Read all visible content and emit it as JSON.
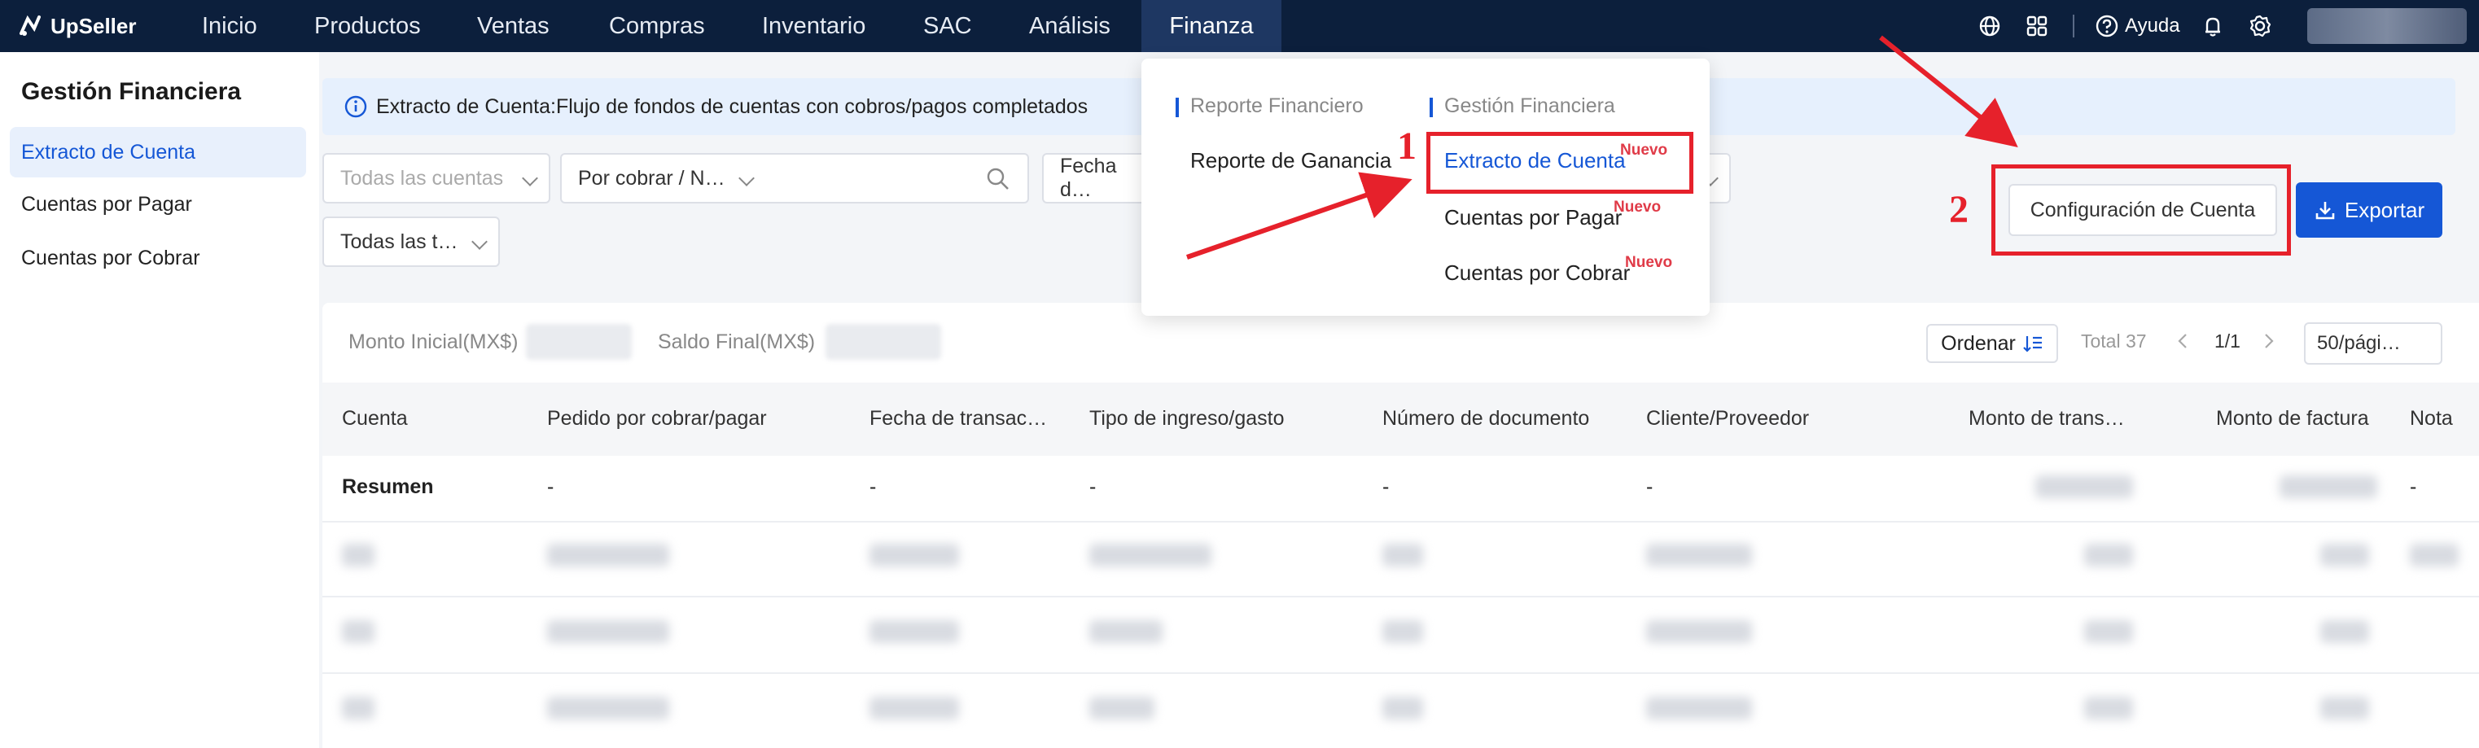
{
  "brand": "UpSeller",
  "nav": {
    "items": [
      "Inicio",
      "Productos",
      "Ventas",
      "Compras",
      "Inventario",
      "SAC",
      "Análisis",
      "Finanza"
    ],
    "active": "Finanza",
    "help_label": "Ayuda",
    "icons": [
      "globe-icon",
      "apps-grid-icon",
      "help-circle-icon",
      "bell-icon",
      "gear-icon"
    ]
  },
  "sidebar": {
    "title": "Gestión Financiera",
    "items": [
      {
        "label": "Extracto de Cuenta",
        "active": true
      },
      {
        "label": "Cuentas por Pagar",
        "active": false
      },
      {
        "label": "Cuentas por Cobrar",
        "active": false
      }
    ]
  },
  "banner": {
    "text": "Extracto de Cuenta:Flujo de fondos de cuentas con cobros/pagos completados"
  },
  "filters": {
    "accounts_placeholder": "Todas las cuentas",
    "status": "Por cobrar / N…",
    "search_value": "",
    "date": "Fecha d…",
    "types": "Todas las t…"
  },
  "actions": {
    "config_label": "Configuración de Cuenta",
    "export_label": "Exportar"
  },
  "summary": {
    "initial_label": "Monto Inicial(MX$)",
    "final_label": "Saldo Final(MX$)"
  },
  "pager": {
    "sort_label": "Ordenar",
    "total": "Total 37",
    "current": "1/1",
    "page_size": "50/pági…"
  },
  "table": {
    "columns": [
      "Cuenta",
      "Pedido por cobrar/pagar",
      "Fecha de transac…",
      "Tipo de ingreso/gasto",
      "Número de documento",
      "Cliente/Proveedor",
      "Monto de trans…",
      "Monto de factura",
      "Nota"
    ],
    "summary_row": {
      "label": "Resumen",
      "dash": "-"
    }
  },
  "dropdown": {
    "col1_head": "Reporte Financiero",
    "col1_items": [
      "Reporte de Ganancia"
    ],
    "col2_head": "Gestión Financiera",
    "col2_items": [
      "Extracto de Cuenta",
      "Cuentas por Pagar",
      "Cuentas por Cobrar"
    ],
    "badge": "Nuevo"
  },
  "annotations": {
    "step1": "1",
    "step2": "2",
    "color": "#e6212b"
  },
  "colors": {
    "nav_bg": "#0c1f3c",
    "primary": "#1557d6",
    "highlight": "#e6212b"
  }
}
